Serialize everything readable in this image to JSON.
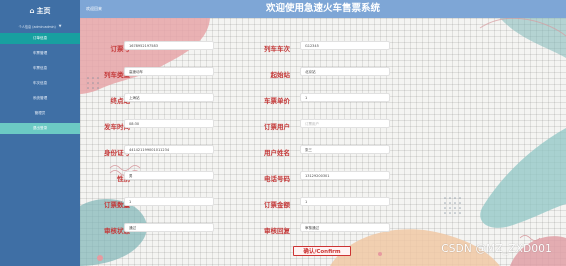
{
  "colors": {
    "sidebar_bg": "#3f6fa5",
    "header_bg": "#7ea6d6",
    "active_item": "#18a0a0",
    "label_red": "#c43838",
    "button_border": "#cc3333"
  },
  "sidebar": {
    "home": "主页",
    "home_icon": "home-icon",
    "user": "个人信息 (admin:admin)",
    "items": [
      {
        "label": "订单信息"
      },
      {
        "label": "车票管理"
      },
      {
        "label": "车票信息"
      },
      {
        "label": "车次信息"
      },
      {
        "label": "系统管理"
      },
      {
        "label": "管理员"
      },
      {
        "label": "退出登录"
      }
    ]
  },
  "header": {
    "breadcrumb": "欢迎回来",
    "title": "欢迎使用急速火车售票系统"
  },
  "form": {
    "fields": [
      {
        "label": "订票号",
        "value": "1678952197583",
        "placeholder": ""
      },
      {
        "label": "列车车次",
        "value": "G12345",
        "placeholder": ""
      },
      {
        "label": "列车类型",
        "value": "高速动车",
        "placeholder": ""
      },
      {
        "label": "起始站",
        "value": "北京站",
        "placeholder": ""
      },
      {
        "label": "终点站",
        "value": "上海站",
        "placeholder": ""
      },
      {
        "label": "车票单价",
        "value": "1",
        "placeholder": ""
      },
      {
        "label": "发车时间",
        "value": "08:30",
        "placeholder": ""
      },
      {
        "label": "订票用户",
        "value": "",
        "placeholder": "订票用户"
      },
      {
        "label": "身份证号",
        "value": "441421199001011234",
        "placeholder": ""
      },
      {
        "label": "用户姓名",
        "value": "张三",
        "placeholder": ""
      },
      {
        "label": "性别",
        "value": "男",
        "placeholder": ""
      },
      {
        "label": "电话号码",
        "value": "13129200301",
        "placeholder": ""
      },
      {
        "label": "订票数量",
        "value": "1",
        "placeholder": ""
      },
      {
        "label": "订票金额",
        "value": "1",
        "placeholder": ""
      },
      {
        "label": "审核状态",
        "value": "通过",
        "placeholder": ""
      },
      {
        "label": "审核回复",
        "value": "审核通过",
        "placeholder": ""
      }
    ],
    "confirm_button": "确认/Confirm"
  },
  "watermark": "CSDN @MZ_ZXD001"
}
